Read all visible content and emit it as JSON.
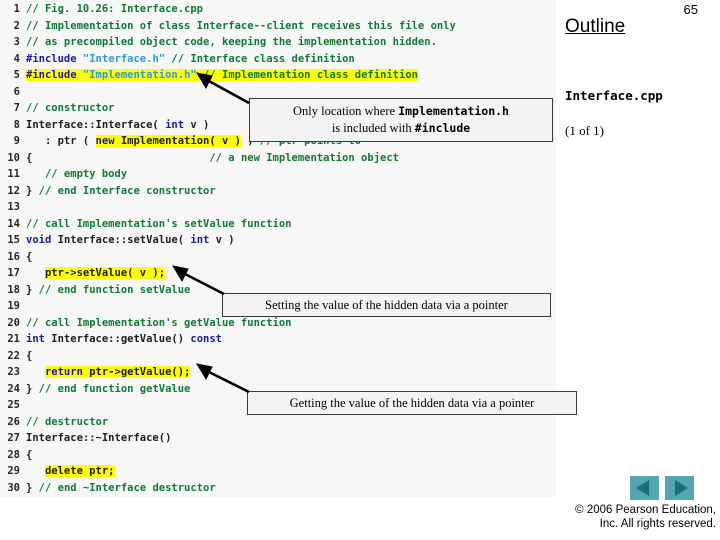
{
  "page": {
    "number": "65"
  },
  "outline": {
    "title": "Outline",
    "file": "Interface.cpp",
    "count": "(1 of 1)"
  },
  "code": {
    "lines": [
      {
        "n": "1",
        "tokens": [
          {
            "t": "// Fig. 10.26: Interface.cpp",
            "c": "cmt"
          }
        ]
      },
      {
        "n": "2",
        "tokens": [
          {
            "t": "// Implementation of class Interface--client receives this file only",
            "c": "cmt"
          }
        ]
      },
      {
        "n": "3",
        "tokens": [
          {
            "t": "// as precompiled object code, keeping the implementation hidden.",
            "c": "cmt"
          }
        ]
      },
      {
        "n": "4",
        "tokens": [
          {
            "t": "#include ",
            "c": "pre"
          },
          {
            "t": "\"Interface.h\"",
            "c": "str"
          },
          {
            "t": " ",
            "c": "pln"
          },
          {
            "t": "// Interface class definition",
            "c": "cmt"
          }
        ]
      },
      {
        "n": "5",
        "tokens": [
          {
            "t": "#include ",
            "c": "pre hl"
          },
          {
            "t": "\"Implementation.h\"",
            "c": "str hl"
          },
          {
            "t": " ",
            "c": "pln hl"
          },
          {
            "t": "// Implementation class definition",
            "c": "cmt hl"
          }
        ]
      },
      {
        "n": "6",
        "tokens": []
      },
      {
        "n": "7",
        "tokens": [
          {
            "t": "// constructor",
            "c": "cmt"
          }
        ]
      },
      {
        "n": "8",
        "tokens": [
          {
            "t": "Interface::Interface( ",
            "c": "pln"
          },
          {
            "t": "int",
            "c": "kw"
          },
          {
            "t": " v )",
            "c": "pln"
          }
        ]
      },
      {
        "n": "9",
        "tokens": [
          {
            "t": "   : ptr ( ",
            "c": "pln"
          },
          {
            "t": "new",
            "c": "kw hl"
          },
          {
            "t": " Implementation( v )",
            "c": "pln hl"
          },
          {
            "t": " )",
            "c": "pln"
          },
          {
            "t": " // ptr points to",
            "c": "cmt"
          }
        ]
      },
      {
        "n": "10",
        "tokens": [
          {
            "t": "{",
            "c": "pln"
          },
          {
            "t": "                            // a new Implementation object",
            "c": "cmt"
          }
        ]
      },
      {
        "n": "11",
        "tokens": [
          {
            "t": "   ",
            "c": "pln"
          },
          {
            "t": "// empty body",
            "c": "cmt"
          }
        ]
      },
      {
        "n": "12",
        "tokens": [
          {
            "t": "} ",
            "c": "pln"
          },
          {
            "t": "// end Interface constructor",
            "c": "cmt"
          }
        ]
      },
      {
        "n": "13",
        "tokens": []
      },
      {
        "n": "14",
        "tokens": [
          {
            "t": "// call Implementation's setValue function",
            "c": "cmt"
          }
        ]
      },
      {
        "n": "15",
        "tokens": [
          {
            "t": "void",
            "c": "kw"
          },
          {
            "t": " Interface::setValue( ",
            "c": "pln"
          },
          {
            "t": "int",
            "c": "kw"
          },
          {
            "t": " v )",
            "c": "pln"
          }
        ]
      },
      {
        "n": "16",
        "tokens": [
          {
            "t": "{",
            "c": "pln"
          }
        ]
      },
      {
        "n": "17",
        "tokens": [
          {
            "t": "   ",
            "c": "pln"
          },
          {
            "t": "ptr->setValue( v );",
            "c": "pln hl"
          }
        ]
      },
      {
        "n": "18",
        "tokens": [
          {
            "t": "} ",
            "c": "pln"
          },
          {
            "t": "// end function setValue",
            "c": "cmt"
          }
        ]
      },
      {
        "n": "19",
        "tokens": []
      },
      {
        "n": "20",
        "tokens": [
          {
            "t": "// call Implementation's getValue function",
            "c": "cmt"
          }
        ]
      },
      {
        "n": "21",
        "tokens": [
          {
            "t": "int",
            "c": "kw"
          },
          {
            "t": " Interface::getValue() ",
            "c": "pln"
          },
          {
            "t": "const",
            "c": "kw"
          }
        ]
      },
      {
        "n": "22",
        "tokens": [
          {
            "t": "{",
            "c": "pln"
          }
        ]
      },
      {
        "n": "23",
        "tokens": [
          {
            "t": "   ",
            "c": "pln"
          },
          {
            "t": "return",
            "c": "kw hl"
          },
          {
            "t": " ptr->getValue();",
            "c": "pln hl"
          }
        ]
      },
      {
        "n": "24",
        "tokens": [
          {
            "t": "} ",
            "c": "pln"
          },
          {
            "t": "// end function getValue",
            "c": "cmt"
          }
        ]
      },
      {
        "n": "25",
        "tokens": []
      },
      {
        "n": "26",
        "tokens": [
          {
            "t": "// destructor",
            "c": "cmt"
          }
        ]
      },
      {
        "n": "27",
        "tokens": [
          {
            "t": "Interface::~Interface()",
            "c": "pln"
          }
        ]
      },
      {
        "n": "28",
        "tokens": [
          {
            "t": "{",
            "c": "pln"
          }
        ]
      },
      {
        "n": "29",
        "tokens": [
          {
            "t": "   ",
            "c": "pln"
          },
          {
            "t": "delete ptr;",
            "c": "pln hl"
          }
        ]
      },
      {
        "n": "30",
        "tokens": [
          {
            "t": "} ",
            "c": "pln"
          },
          {
            "t": "// end ~Interface destructor",
            "c": "cmt"
          }
        ]
      }
    ]
  },
  "callouts": {
    "include": {
      "line1_pre": "Only location where ",
      "line1_code": "Implementation.h",
      "line2_pre": "is included with ",
      "line2_code": "#include"
    },
    "setting": {
      "text": "Setting the value of the hidden data via a pointer"
    },
    "getting": {
      "text": "Getting the value of the hidden data via a pointer"
    }
  },
  "nav": {
    "prev_label": "previous-slide",
    "next_label": "next-slide"
  },
  "footer": {
    "line1": "© 2006 Pearson Education,",
    "line2": "Inc.  All rights reserved."
  },
  "colors": {
    "highlight": "#ffff00",
    "comment": "#0f7a32",
    "keyword": "#1a1aa8",
    "string": "#2f9bd4",
    "nav_button": "#55a6b0",
    "nav_arrow": "#18707d"
  }
}
